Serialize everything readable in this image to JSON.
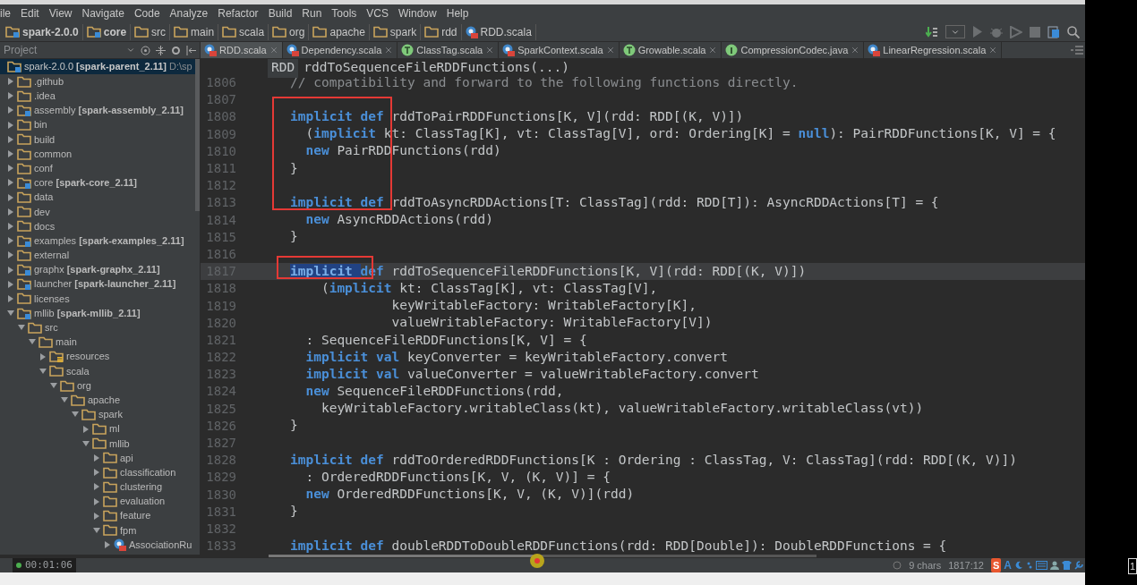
{
  "menu": [
    {
      "label": "ile"
    },
    {
      "label": "Edit"
    },
    {
      "label": "View"
    },
    {
      "label": "Navigate"
    },
    {
      "label": "Code"
    },
    {
      "label": "Analyze"
    },
    {
      "label": "Refactor"
    },
    {
      "label": "Build"
    },
    {
      "label": "Run"
    },
    {
      "label": "Tools"
    },
    {
      "label": "VCS"
    },
    {
      "label": "Window"
    },
    {
      "label": "Help"
    }
  ],
  "breadcrumbs": [
    {
      "label": "spark-2.0.0",
      "kind": "module",
      "bold": true
    },
    {
      "label": "core",
      "kind": "module",
      "bold": true
    },
    {
      "label": "src",
      "kind": "folder",
      "bold": false
    },
    {
      "label": "main",
      "kind": "folder",
      "bold": false
    },
    {
      "label": "scala",
      "kind": "folder",
      "bold": false
    },
    {
      "label": "org",
      "kind": "folder",
      "bold": false
    },
    {
      "label": "apache",
      "kind": "folder",
      "bold": false
    },
    {
      "label": "spark",
      "kind": "folder",
      "bold": false
    },
    {
      "label": "rdd",
      "kind": "folder",
      "bold": false
    },
    {
      "label": "RDD.scala",
      "kind": "scala-file",
      "bold": false
    }
  ],
  "project_panel": {
    "title": "Project",
    "root": {
      "label": "spark-2.0.0 **[spark-parent_2.11]**",
      "path": "D:\\sp",
      "kind": "module"
    },
    "items": [
      {
        "label": ".github",
        "kind": "folder",
        "expanded": false
      },
      {
        "label": ".idea",
        "kind": "folder",
        "expanded": false
      },
      {
        "label": "assembly **[spark-assembly_2.11]**",
        "kind": "module",
        "expanded": false
      },
      {
        "label": "bin",
        "kind": "folder",
        "expanded": false
      },
      {
        "label": "build",
        "kind": "folder",
        "expanded": false
      },
      {
        "label": "common",
        "kind": "folder",
        "expanded": false
      },
      {
        "label": "conf",
        "kind": "folder",
        "expanded": false
      },
      {
        "label": "core **[spark-core_2.11]**",
        "kind": "module",
        "expanded": false
      },
      {
        "label": "data",
        "kind": "folder",
        "expanded": false
      },
      {
        "label": "dev",
        "kind": "folder",
        "expanded": false
      },
      {
        "label": "docs",
        "kind": "folder",
        "expanded": false
      },
      {
        "label": "examples **[spark-examples_2.11]**",
        "kind": "module",
        "expanded": false
      },
      {
        "label": "external",
        "kind": "folder",
        "expanded": false
      },
      {
        "label": "graphx **[spark-graphx_2.11]**",
        "kind": "module",
        "expanded": false
      },
      {
        "label": "launcher **[spark-launcher_2.11]**",
        "kind": "module",
        "expanded": false
      },
      {
        "label": "licenses",
        "kind": "folder",
        "expanded": false
      },
      {
        "label": "mllib **[spark-mllib_2.11]**",
        "kind": "module",
        "expanded": true,
        "children": [
          {
            "label": "src",
            "kind": "folder",
            "expanded": true,
            "children": [
              {
                "label": "main",
                "kind": "folder",
                "expanded": true,
                "children": [
                  {
                    "label": "resources",
                    "kind": "resources",
                    "expanded": false
                  },
                  {
                    "label": "scala",
                    "kind": "folder",
                    "expanded": true,
                    "children": [
                      {
                        "label": "org",
                        "kind": "folder",
                        "expanded": true,
                        "children": [
                          {
                            "label": "apache",
                            "kind": "folder",
                            "expanded": true,
                            "children": [
                              {
                                "label": "spark",
                                "kind": "folder",
                                "expanded": true,
                                "children": [
                                  {
                                    "label": "ml",
                                    "kind": "folder",
                                    "expanded": false
                                  },
                                  {
                                    "label": "mllib",
                                    "kind": "folder",
                                    "expanded": true,
                                    "children": [
                                      {
                                        "label": "api",
                                        "kind": "folder",
                                        "expanded": false
                                      },
                                      {
                                        "label": "classification",
                                        "kind": "folder",
                                        "expanded": false
                                      },
                                      {
                                        "label": "clustering",
                                        "kind": "folder",
                                        "expanded": false
                                      },
                                      {
                                        "label": "evaluation",
                                        "kind": "folder",
                                        "expanded": false
                                      },
                                      {
                                        "label": "feature",
                                        "kind": "folder",
                                        "expanded": false
                                      },
                                      {
                                        "label": "fpm",
                                        "kind": "folder",
                                        "expanded": true,
                                        "children": [
                                          {
                                            "label": "AssociationRu",
                                            "kind": "scala-file",
                                            "expanded": false
                                          }
                                        ]
                                      }
                                    ]
                                  }
                                ]
                              }
                            ]
                          }
                        ]
                      }
                    ]
                  }
                ]
              }
            ]
          }
        ]
      }
    ]
  },
  "tabs": [
    {
      "label": "RDD.scala",
      "kind": "scala-class",
      "selected": true
    },
    {
      "label": "Dependency.scala",
      "kind": "scala-class",
      "selected": false
    },
    {
      "label": "ClassTag.scala",
      "kind": "trait",
      "selected": false
    },
    {
      "label": "SparkContext.scala",
      "kind": "scala-class",
      "selected": false
    },
    {
      "label": "Growable.scala",
      "kind": "trait",
      "selected": false
    },
    {
      "label": "CompressionCodec.java",
      "kind": "interface",
      "selected": false
    },
    {
      "label": "LinearRegression.scala",
      "kind": "scala-class",
      "selected": false
    }
  ],
  "context_popup": {
    "class": "RDD",
    "member": "rddToSequenceFileRDDFunctions(...)"
  },
  "code_lines": [
    {
      "number": "1806",
      "current": false,
      "tokens": [
        {
          "kind": "comment",
          "text": "// compatibility and forward to the following functions directly."
        }
      ]
    },
    {
      "number": "1807",
      "current": false
    },
    {
      "number": "1808",
      "current": false,
      "tokens": [
        {
          "kind": "kw",
          "text": "implicit def"
        },
        {
          "kind": "plain",
          "text": " rddToPairRDDFunctions[K, V](rdd: RDD[(K, V)])"
        }
      ]
    },
    {
      "number": "1809",
      "current": false,
      "tokens": [
        {
          "kind": "plain",
          "text": "  ("
        },
        {
          "kind": "kw",
          "text": "implicit"
        },
        {
          "kind": "plain",
          "text": " kt: ClassTag[K], vt: ClassTag[V], ord: Ordering[K] = "
        },
        {
          "kind": "kw",
          "text": "null"
        },
        {
          "kind": "plain",
          "text": "): PairRDDFunctions[K, V] = {"
        }
      ]
    },
    {
      "number": "1810",
      "current": false,
      "tokens": [
        {
          "kind": "kw",
          "text": "  new"
        },
        {
          "kind": "plain",
          "text": " PairRDDFunctions(rdd)"
        }
      ]
    },
    {
      "number": "1811",
      "current": false,
      "tokens": [
        {
          "kind": "plain",
          "text": "}"
        }
      ]
    },
    {
      "number": "1812",
      "current": false
    },
    {
      "number": "1813",
      "current": false,
      "tokens": [
        {
          "kind": "kw",
          "text": "implicit def"
        },
        {
          "kind": "plain",
          "text": " rddToAsyncRDDActions[T: ClassTag](rdd: RDD[T]): AsyncRDDActions[T] = {"
        }
      ]
    },
    {
      "number": "1814",
      "current": false,
      "tokens": [
        {
          "kind": "kw",
          "text": "  new"
        },
        {
          "kind": "plain",
          "text": " AsyncRDDActions(rdd)"
        }
      ]
    },
    {
      "number": "1815",
      "current": false,
      "tokens": [
        {
          "kind": "plain",
          "text": "}"
        }
      ]
    },
    {
      "number": "1816",
      "current": false
    },
    {
      "number": "1817",
      "current": true,
      "tokens": [
        {
          "kind": "selected",
          "text": "implicit "
        },
        {
          "kind": "kw",
          "text": "def"
        },
        {
          "kind": "plain",
          "text": " rddToSequenceFileRDDFunctions[K, V](rdd: RDD[(K, V)])"
        }
      ]
    },
    {
      "number": "1818",
      "current": false,
      "tokens": [
        {
          "kind": "plain",
          "text": "    ("
        },
        {
          "kind": "kw",
          "text": "implicit"
        },
        {
          "kind": "plain",
          "text": " kt: ClassTag[K], vt: ClassTag[V],"
        }
      ]
    },
    {
      "number": "1819",
      "current": false,
      "tokens": [
        {
          "kind": "plain",
          "text": "             keyWritableFactory: WritableFactory[K],"
        }
      ]
    },
    {
      "number": "1820",
      "current": false,
      "tokens": [
        {
          "kind": "plain",
          "text": "             valueWritableFactory: WritableFactory[V])"
        }
      ]
    },
    {
      "number": "1821",
      "current": false,
      "tokens": [
        {
          "kind": "plain",
          "text": "  : SequenceFileRDDFunctions[K, V] = {"
        }
      ]
    },
    {
      "number": "1822",
      "current": false,
      "tokens": [
        {
          "kind": "kw",
          "text": "  implicit val"
        },
        {
          "kind": "plain",
          "text": " keyConverter = keyWritableFactory.convert"
        }
      ]
    },
    {
      "number": "1823",
      "current": false,
      "tokens": [
        {
          "kind": "kw",
          "text": "  implicit val"
        },
        {
          "kind": "plain",
          "text": " valueConverter = valueWritableFactory.convert"
        }
      ]
    },
    {
      "number": "1824",
      "current": false,
      "tokens": [
        {
          "kind": "kw",
          "text": "  new"
        },
        {
          "kind": "plain",
          "text": " SequenceFileRDDFunctions(rdd,"
        }
      ]
    },
    {
      "number": "1825",
      "current": false,
      "tokens": [
        {
          "kind": "plain",
          "text": "    keyWritableFactory.writableClass(kt), valueWritableFactory.writableClass(vt))"
        }
      ]
    },
    {
      "number": "1826",
      "current": false,
      "tokens": [
        {
          "kind": "plain",
          "text": "}"
        }
      ]
    },
    {
      "number": "1827",
      "current": false
    },
    {
      "number": "1828",
      "current": false,
      "tokens": [
        {
          "kind": "kw",
          "text": "implicit def"
        },
        {
          "kind": "plain",
          "text": " rddToOrderedRDDFunctions[K : Ordering : ClassTag, V: ClassTag](rdd: RDD[(K, V)])"
        }
      ]
    },
    {
      "number": "1829",
      "current": false,
      "tokens": [
        {
          "kind": "plain",
          "text": "  : OrderedRDDFunctions[K, V, (K, V)] = {"
        }
      ]
    },
    {
      "number": "1830",
      "current": false,
      "tokens": [
        {
          "kind": "kw",
          "text": "  new"
        },
        {
          "kind": "plain",
          "text": " OrderedRDDFunctions[K, V, (K, V)](rdd)"
        }
      ]
    },
    {
      "number": "1831",
      "current": false,
      "tokens": [
        {
          "kind": "plain",
          "text": "}"
        }
      ]
    },
    {
      "number": "1832",
      "current": false
    },
    {
      "number": "1833",
      "current": false,
      "tokens": [
        {
          "kind": "kw",
          "text": "implicit def"
        },
        {
          "kind": "plain",
          "text": " doubleRDDToDoubleRDDFunctions(rdd: RDD[Double]): DoubleRDDFunctions = {"
        }
      ]
    }
  ],
  "video": {
    "time": "00:01:06",
    "level": 0.49
  },
  "status_bar": {
    "selection": "9 chars",
    "position": "1817:12",
    "ime_labels": [
      "S",
      "A"
    ]
  },
  "edge_label": "1"
}
